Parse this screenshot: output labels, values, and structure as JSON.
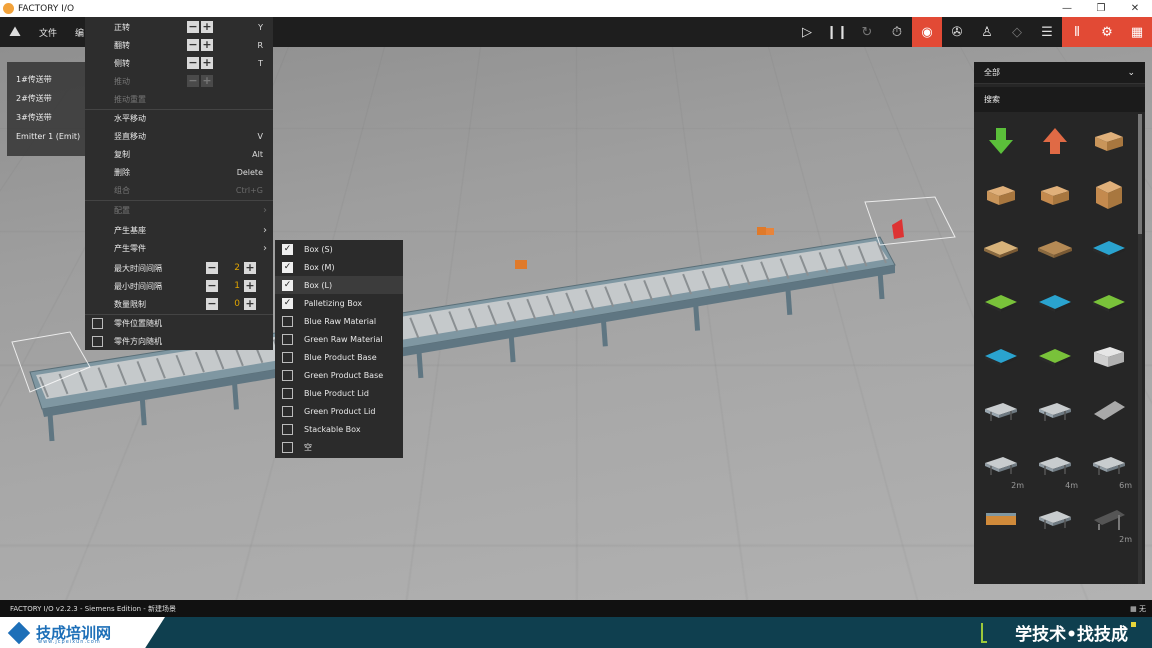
{
  "window": {
    "title": "FACTORY I/O",
    "controls": [
      "—",
      "❐",
      "✕"
    ]
  },
  "toolbar": {
    "menus": [
      "文件",
      "编"
    ],
    "buttons": [
      {
        "icon": "play-icon",
        "glyph": "▷",
        "style": "normal"
      },
      {
        "icon": "pause-icon",
        "glyph": "❙❙",
        "style": "normal"
      },
      {
        "icon": "reset-icon",
        "glyph": "↻",
        "style": "dim"
      },
      {
        "icon": "timer-icon",
        "glyph": "⏱",
        "style": "normal"
      },
      {
        "icon": "camera-orbit-icon",
        "glyph": "◉",
        "style": "red"
      },
      {
        "icon": "fly-camera-icon",
        "glyph": "✇",
        "style": "normal"
      },
      {
        "icon": "first-person-icon",
        "glyph": "♙",
        "style": "normal"
      },
      {
        "icon": "sensor-icon",
        "glyph": "◇",
        "style": "dim"
      },
      {
        "icon": "list-icon",
        "glyph": "☰",
        "style": "normal"
      },
      {
        "icon": "io-tags-icon",
        "glyph": "⫴",
        "style": "red"
      },
      {
        "icon": "drivers-icon",
        "glyph": "⚙",
        "style": "red"
      },
      {
        "icon": "parts-grid-icon",
        "glyph": "▦",
        "style": "red"
      }
    ]
  },
  "object_list": [
    "1#传送带",
    "2#传送带",
    "3#传送带",
    "Emitter 1 (Emit)"
  ],
  "context_menu": {
    "transform": [
      {
        "label": "正转",
        "shortcut": "Y",
        "enabled": true
      },
      {
        "label": "翻转",
        "shortcut": "R",
        "enabled": true
      },
      {
        "label": "侧转",
        "shortcut": "T",
        "enabled": true
      },
      {
        "label": "推动",
        "shortcut": "",
        "enabled": false
      },
      {
        "label": "推动重置",
        "shortcut": "",
        "enabled": false
      }
    ],
    "actions": [
      {
        "label": "水平移动",
        "shortcut": "",
        "enabled": true
      },
      {
        "label": "竖直移动",
        "shortcut": "V",
        "enabled": true
      },
      {
        "label": "复制",
        "shortcut": "Alt",
        "enabled": true
      },
      {
        "label": "删除",
        "shortcut": "Delete",
        "enabled": true
      },
      {
        "label": "组合",
        "shortcut": "Ctrl+G",
        "enabled": false
      }
    ],
    "submenus": [
      {
        "label": "配置",
        "enabled": false
      },
      {
        "label": "产生基座",
        "enabled": true
      },
      {
        "label": "产生零件",
        "enabled": true
      }
    ],
    "numbers": [
      {
        "label": "最大时间间隔",
        "value": "2"
      },
      {
        "label": "最小时间间隔",
        "value": "1"
      },
      {
        "label": "数量限制",
        "value": "0"
      }
    ],
    "checks": [
      {
        "label": "零件位置随机",
        "checked": false
      },
      {
        "label": "零件方向随机",
        "checked": false
      }
    ]
  },
  "parts_submenu": [
    {
      "label": "Box (S)",
      "checked": true
    },
    {
      "label": "Box (M)",
      "checked": true
    },
    {
      "label": "Box (L)",
      "checked": true
    },
    {
      "label": "Palletizing Box",
      "checked": true
    },
    {
      "label": "Blue Raw Material",
      "checked": false
    },
    {
      "label": "Green Raw Material",
      "checked": false
    },
    {
      "label": "Blue Product Base",
      "checked": false
    },
    {
      "label": "Green Product Base",
      "checked": false
    },
    {
      "label": "Blue Product Lid",
      "checked": false
    },
    {
      "label": "Green Product Lid",
      "checked": false
    },
    {
      "label": "Stackable Box",
      "checked": false
    },
    {
      "label": "空",
      "checked": false
    }
  ],
  "library": {
    "category": "全部",
    "search_label": "搜索",
    "items": [
      {
        "name": "remover-arrow-icon",
        "kind": "arrow-down",
        "color": "#5bbf3a",
        "tag": ""
      },
      {
        "name": "emitter-arrow-icon",
        "kind": "arrow-up",
        "color": "#e06a45",
        "tag": ""
      },
      {
        "name": "small-box-icon",
        "kind": "box-flat",
        "color": "#c9955a",
        "tag": ""
      },
      {
        "name": "medium-box-icon",
        "kind": "box-flat",
        "color": "#c9955a",
        "tag": ""
      },
      {
        "name": "large-box-icon",
        "kind": "box-flat",
        "color": "#c48a4e",
        "tag": ""
      },
      {
        "name": "cube-box-icon",
        "kind": "box-cube",
        "color": "#c48a4e",
        "tag": ""
      },
      {
        "name": "pallet-icon",
        "kind": "pallet",
        "color": "#d7b27a",
        "tag": ""
      },
      {
        "name": "pallet-dark-icon",
        "kind": "pallet",
        "color": "#b58a55",
        "tag": ""
      },
      {
        "name": "blue-raw-material-icon",
        "kind": "tile",
        "color": "#2aa3cf",
        "tag": ""
      },
      {
        "name": "green-raw-material-icon",
        "kind": "tile",
        "color": "#79c23a",
        "tag": ""
      },
      {
        "name": "blue-product-base-icon",
        "kind": "tile",
        "color": "#2aa3cf",
        "tag": ""
      },
      {
        "name": "green-product-base-icon",
        "kind": "tile",
        "color": "#79c23a",
        "tag": ""
      },
      {
        "name": "blue-product-lid-icon",
        "kind": "tile",
        "color": "#2aa3cf",
        "tag": ""
      },
      {
        "name": "green-product-lid-icon",
        "kind": "tile",
        "color": "#79c23a",
        "tag": ""
      },
      {
        "name": "stackable-box-icon",
        "kind": "crate",
        "color": "#cfcfcf",
        "tag": ""
      },
      {
        "name": "conveyor-turn-icon",
        "kind": "conveyor",
        "color": "#9aa7b0",
        "tag": ""
      },
      {
        "name": "conveyor-scale-icon",
        "kind": "conveyor",
        "color": "#9aa7b0",
        "tag": ""
      },
      {
        "name": "plate-icon",
        "kind": "plate",
        "color": "#a9a9a9",
        "tag": ""
      },
      {
        "name": "roller-conveyor-2m-icon",
        "kind": "conveyor",
        "color": "#8f9aa2",
        "tag": "2m"
      },
      {
        "name": "roller-conveyor-4m-icon",
        "kind": "conveyor",
        "color": "#8f9aa2",
        "tag": "4m"
      },
      {
        "name": "roller-conveyor-6m-icon",
        "kind": "conveyor",
        "color": "#8f9aa2",
        "tag": "6m"
      },
      {
        "name": "belt-conveyor-icon",
        "kind": "belt",
        "color": "#d08a3a",
        "tag": ""
      },
      {
        "name": "roller-curve-icon",
        "kind": "conveyor",
        "color": "#8f9aa2",
        "tag": ""
      },
      {
        "name": "slope-conveyor-2m-icon",
        "kind": "slope",
        "color": "#555555",
        "tag": "2m"
      }
    ]
  },
  "status_bar": {
    "text": "FACTORY I/O v2.2.3 - Siemens Edition - 新建场景",
    "right": "无"
  },
  "banner": {
    "brand": "技成培训网",
    "brand_url": "www.jcpeixun.com",
    "slogan": "学技术•找技成"
  }
}
